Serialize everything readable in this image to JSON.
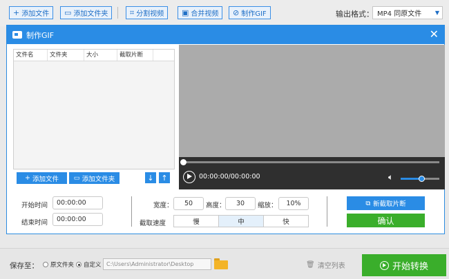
{
  "toolbar": {
    "add_file": "添加文件",
    "add_folder": "添加文件夹",
    "split_video": "分割视频",
    "merge_video": "合并视频",
    "make_gif": "制作GIF",
    "output_format_label": "输出格式：",
    "output_format_value": "MP4  同原文件"
  },
  "dialog": {
    "title": "制作GIF",
    "close": "✕",
    "table_headers": [
      "文件名",
      "文件夹",
      "大小",
      "截取片断",
      ""
    ],
    "add_file": "添加文件",
    "add_folder": "添加文件夹",
    "move_down": "↓",
    "move_up": "↑",
    "player": {
      "time": "00:00:00/00:00:00",
      "progress": 0,
      "volume": 0.55
    },
    "start_time_label": "开始时间",
    "start_time_value": "00:00:00",
    "end_time_label": "结束时间",
    "end_time_value": "00:00:00",
    "width_label": "宽度：",
    "width_value": "50",
    "height_label": "高度：",
    "height_value": "30",
    "scale_label": "缩放：",
    "scale_value": "10%",
    "speed_label": "截取速度",
    "speed_options": [
      "慢",
      "中",
      "快"
    ],
    "speed_selected": "中",
    "new_clip": "新截取片断",
    "confirm": "确认"
  },
  "bottom": {
    "save_to_label": "保存至：",
    "option_original": "原文件夹",
    "option_custom": "自定义",
    "selected_option": "自定义",
    "path": "C:\\Users\\Administrator\\Desktop",
    "clear_list": "清空列表",
    "start_convert": "开始转换"
  },
  "colors": {
    "accent": "#2a8ce5",
    "confirm_green": "#3aae2b",
    "video_bg": "#ababab",
    "player_bar": "#2f2f2f"
  }
}
